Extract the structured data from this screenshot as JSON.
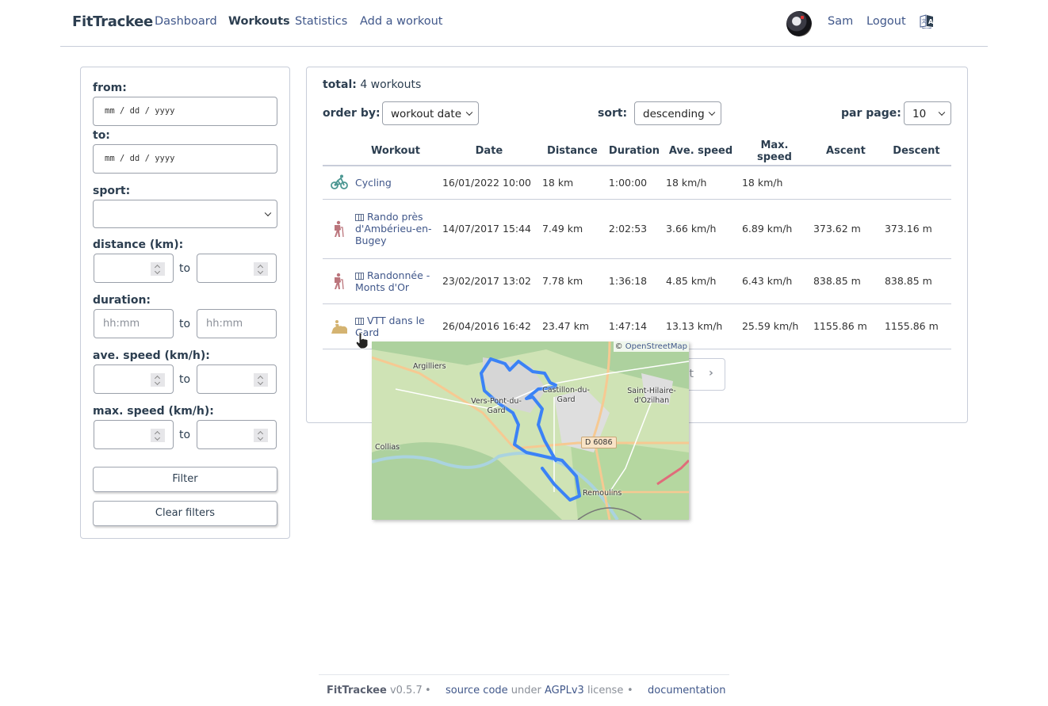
{
  "navbar": {
    "brand": "FitTrackee",
    "links": [
      {
        "label": "Dashboard",
        "active": false
      },
      {
        "label": "Workouts",
        "active": true
      },
      {
        "label": "Statistics",
        "active": false
      },
      {
        "label": "Add a workout",
        "active": false
      }
    ],
    "user": "Sam",
    "logout": "Logout",
    "language_icon": "translate-icon"
  },
  "filters": {
    "from_label": "from:",
    "from_placeholder": "mm / dd / yyyy",
    "to_label": "to:",
    "to_placeholder": "mm / dd / yyyy",
    "sport_label": "sport:",
    "sport_value": "",
    "distance_label": "distance (km):",
    "duration_label": "duration:",
    "duration_placeholder": "hh:mm",
    "ave_speed_label": "ave. speed (km/h):",
    "max_speed_label": "max. speed (km/h):",
    "range_sep": "to",
    "filter_button": "Filter",
    "clear_button": "Clear filters"
  },
  "workouts": {
    "total_label": "total:",
    "total_value": "4 workouts",
    "order_by_label": "order by:",
    "order_by_value": "workout date",
    "sort_label": "sort:",
    "sort_value": "descending",
    "per_page_label": "par page:",
    "per_page_value": "10",
    "columns": [
      "Workout",
      "Date",
      "Distance",
      "Duration",
      "Ave. speed",
      "Max. speed",
      "Ascent",
      "Descent"
    ],
    "rows": [
      {
        "sport": "cycling",
        "sport_icon": "cycling-icon",
        "color": "#4c9792",
        "has_map": false,
        "title": "Cycling",
        "date": "16/01/2022 10:00",
        "distance": "18 km",
        "duration": "1:00:00",
        "ave_speed": "18 km/h",
        "max_speed": "18 km/h",
        "ascent": "",
        "descent": ""
      },
      {
        "sport": "hiking",
        "sport_icon": "hiking-icon",
        "color": "#bb757c",
        "has_map": true,
        "title": "Rando près d'Ambérieu-en-Bugey",
        "date": "14/07/2017 15:44",
        "distance": "7.49 km",
        "duration": "2:02:53",
        "ave_speed": "3.66 km/h",
        "max_speed": "6.89 km/h",
        "ascent": "373.62 m",
        "descent": "373.16 m"
      },
      {
        "sport": "hiking",
        "sport_icon": "hiking-icon",
        "color": "#bb757c",
        "has_map": true,
        "title": "Randonnée - Monts d'Or",
        "date": "23/02/2017 13:02",
        "distance": "7.78 km",
        "duration": "1:36:18",
        "ave_speed": "4.85 km/h",
        "max_speed": "6.43 km/h",
        "ascent": "838.85 m",
        "descent": "838.85 m"
      },
      {
        "sport": "mountain biking",
        "sport_icon": "mountain-bike-icon",
        "color": "#d4b371",
        "has_map": true,
        "title": "VTT dans le Gard",
        "date": "26/04/2016 16:42",
        "distance": "23.47 km",
        "duration": "1:47:14",
        "ave_speed": "13.13 km/h",
        "max_speed": "25.59 km/h",
        "ascent": "1155.86 m",
        "descent": "1155.86 m"
      }
    ],
    "pagination_next": "next"
  },
  "map_popup": {
    "attribution_prefix": "©",
    "attribution_link": "OpenStreetMap",
    "places": [
      "Argilliers",
      "Castillon-du-Gard",
      "Saint-Hilaire-d'Ozilhan",
      "Vers-Pont-du-Gard",
      "Collias",
      "Remoulins"
    ],
    "road_label": "D 6086",
    "route_color": "#3b82f6"
  },
  "footer": {
    "app_name": "FitTrackee",
    "version": "v0.5.7",
    "sep": "•",
    "source_code": "source code",
    "under": "under",
    "license_name": "AGPLv3",
    "license_word": "license",
    "documentation": "documentation"
  }
}
